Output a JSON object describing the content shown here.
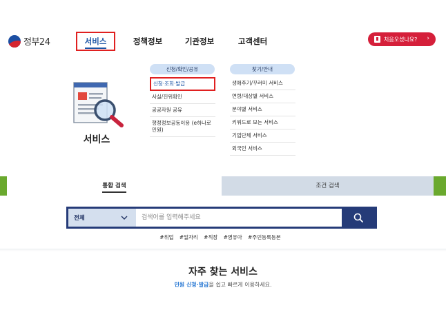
{
  "header": {
    "logo_text": "정부24",
    "nav": [
      {
        "label": "서비스",
        "active": true
      },
      {
        "label": "정책정보",
        "active": false
      },
      {
        "label": "기관정보",
        "active": false
      },
      {
        "label": "고객센터",
        "active": false
      }
    ],
    "first_visit_label": "처음오셨나요?",
    "first_visit_arrow": "›"
  },
  "mega_menu": {
    "section_title": "서비스",
    "col1": {
      "title": "신청/확인/공유",
      "items": [
        "신청·조회·발급",
        "사실/진위확인",
        "공공자원 공유",
        "행정정보공동이용 (e하나로민원)"
      ]
    },
    "col2": {
      "title": "찾기/안내",
      "items": [
        "생애주기/꾸러미 서비스",
        "연령/대상별 서비스",
        "분야별 서비스",
        "키워드로 보는 서비스",
        "기업단체 서비스",
        "외국인 서비스"
      ]
    }
  },
  "search": {
    "tabs": [
      "통합 검색",
      "조건 검색"
    ],
    "scope_label": "전체",
    "placeholder": "검색어를 입력해주세요",
    "tags": [
      "#취업",
      "#일자리",
      "#직장",
      "#영유아",
      "#주민등록등본"
    ]
  },
  "frequent": {
    "title": "자주 찾는 서비스",
    "sub_highlight": "민원 신청·발급",
    "sub_rest": "을 쉽고 빠르게 이용하세요."
  },
  "colors": {
    "brand_blue": "#1b54a5",
    "navy": "#253b78",
    "highlight_red": "#e02020",
    "button_red": "#d51f3a",
    "strip_green": "#6aa92e"
  }
}
